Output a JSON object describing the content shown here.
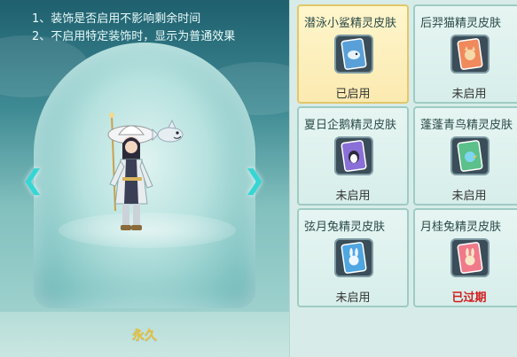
{
  "preview": {
    "tip_1": "1、装饰是否启用不影响剩余时间",
    "tip_2": "2、不启用特定装饰时，显示为普通效果",
    "duration": "永久"
  },
  "skins": [
    {
      "name": "潜泳小鲨精灵皮肤",
      "status": "已启用",
      "card_color": "#5aa0d8",
      "icon": "shark-spirit-card-icon"
    },
    {
      "name": "后羿猫精灵皮肤",
      "status": "未启用",
      "card_color": "#f08a5d",
      "icon": "cat-spirit-card-icon"
    },
    {
      "name": "夏日企鹅精灵皮肤",
      "status": "未启用",
      "card_color": "#8a6fd8",
      "icon": "penguin-spirit-card-icon"
    },
    {
      "name": "蓬蓬青鸟精灵皮肤",
      "status": "未启用",
      "card_color": "#5cc08a",
      "icon": "bluebird-spirit-card-icon"
    },
    {
      "name": "弦月兔精灵皮肤",
      "status": "未启用",
      "card_color": "#4fa6e0",
      "icon": "crescent-rabbit-card-icon"
    },
    {
      "name": "月桂兔精灵皮肤",
      "status": "已过期",
      "card_color": "#f07a8a",
      "icon": "laurel-rabbit-card-icon"
    }
  ]
}
